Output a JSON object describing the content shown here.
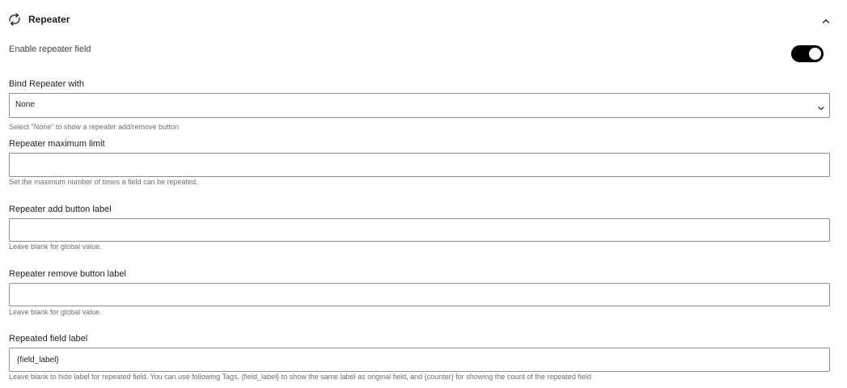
{
  "section": {
    "title": "Repeater",
    "icon": "repeat-icon",
    "collapse_icon": "chevron-up-icon"
  },
  "enable": {
    "label": "Enable repeater field",
    "toggle_on": true
  },
  "bind": {
    "label": "Bind Repeater with",
    "selected": "None",
    "help": "Select \"None\" to show a repeater add/remove button"
  },
  "max_limit": {
    "label": "Repeater maximum limit",
    "value": "",
    "help": "Set the maximum number of times a field can be repeated."
  },
  "add_label": {
    "label": "Repeater add button label",
    "value": "",
    "help": "Leave blank for global value."
  },
  "remove_label": {
    "label": "Repeater remove button label",
    "value": "",
    "help": "Leave blank for global value."
  },
  "repeated_label": {
    "label": "Repeated field label",
    "value": "{field_label}",
    "help": "Leave blank to hide label for repeated field. You can use following Tags, {field_label} to show the same label as original field, and {counter} for showing the count of the repeated field"
  }
}
